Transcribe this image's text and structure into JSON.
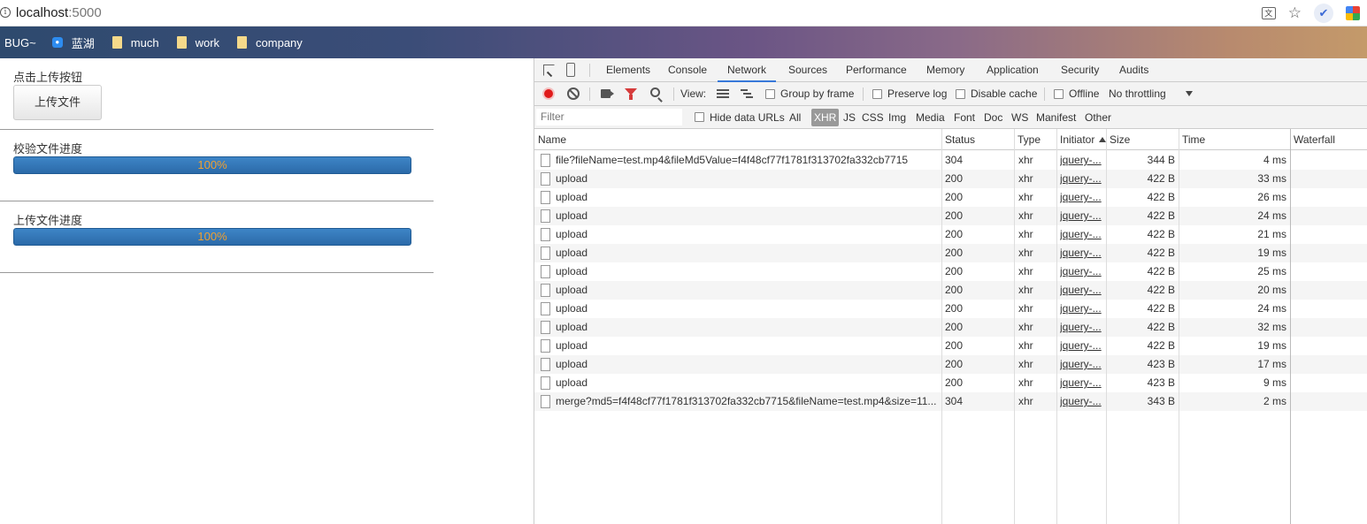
{
  "browser": {
    "url_host": "localhost",
    "url_port": ":5000",
    "info_glyph": "i",
    "translate_glyph": "文",
    "star_glyph": "☆",
    "ext1_glyph": "✔"
  },
  "bookmarks": [
    {
      "label": "BUG~",
      "icon": "none"
    },
    {
      "label": "蓝湖",
      "icon": "lanhu-icon"
    },
    {
      "label": "much",
      "icon": "folder-icon"
    },
    {
      "label": "work",
      "icon": "folder-icon"
    },
    {
      "label": "company",
      "icon": "folder-icon"
    }
  ],
  "page": {
    "upload_label": "点击上传按钮",
    "upload_button": "上传文件",
    "verify_label": "校验文件进度",
    "verify_progress": "100%",
    "verify_value": 1.0,
    "upload_progress_label": "上传文件进度",
    "upload_progress": "100%",
    "upload_value": 1.0
  },
  "devtools": {
    "tabs": [
      "Elements",
      "Console",
      "Network",
      "Sources",
      "Performance",
      "Memory",
      "Application",
      "Security",
      "Audits"
    ],
    "active_tab": "Network",
    "toolbar": {
      "view_label": "View:",
      "group_by_frame": "Group by frame",
      "preserve_log": "Preserve log",
      "disable_cache": "Disable cache",
      "offline": "Offline",
      "throttling": "No throttling"
    },
    "filterbar": {
      "filter_placeholder": "Filter",
      "hide_data_urls": "Hide data URLs",
      "types": [
        "All",
        "XHR",
        "JS",
        "CSS",
        "Img",
        "Media",
        "Font",
        "Doc",
        "WS",
        "Manifest",
        "Other"
      ],
      "active_type": "XHR"
    },
    "columns": [
      "Name",
      "Status",
      "Type",
      "Initiator",
      "Size",
      "Time",
      "Waterfall"
    ],
    "requests": [
      {
        "name": "file?fileName=test.mp4&fileMd5Value=f4f48cf77f1781f313702fa332cb7715",
        "status": "304",
        "type": "xhr",
        "initiator": "jquery-...",
        "size": "344 B",
        "time": "4 ms"
      },
      {
        "name": "upload",
        "status": "200",
        "type": "xhr",
        "initiator": "jquery-...",
        "size": "422 B",
        "time": "33 ms"
      },
      {
        "name": "upload",
        "status": "200",
        "type": "xhr",
        "initiator": "jquery-...",
        "size": "422 B",
        "time": "26 ms"
      },
      {
        "name": "upload",
        "status": "200",
        "type": "xhr",
        "initiator": "jquery-...",
        "size": "422 B",
        "time": "24 ms"
      },
      {
        "name": "upload",
        "status": "200",
        "type": "xhr",
        "initiator": "jquery-...",
        "size": "422 B",
        "time": "21 ms"
      },
      {
        "name": "upload",
        "status": "200",
        "type": "xhr",
        "initiator": "jquery-...",
        "size": "422 B",
        "time": "19 ms"
      },
      {
        "name": "upload",
        "status": "200",
        "type": "xhr",
        "initiator": "jquery-...",
        "size": "422 B",
        "time": "25 ms"
      },
      {
        "name": "upload",
        "status": "200",
        "type": "xhr",
        "initiator": "jquery-...",
        "size": "422 B",
        "time": "20 ms"
      },
      {
        "name": "upload",
        "status": "200",
        "type": "xhr",
        "initiator": "jquery-...",
        "size": "422 B",
        "time": "24 ms"
      },
      {
        "name": "upload",
        "status": "200",
        "type": "xhr",
        "initiator": "jquery-...",
        "size": "422 B",
        "time": "32 ms"
      },
      {
        "name": "upload",
        "status": "200",
        "type": "xhr",
        "initiator": "jquery-...",
        "size": "422 B",
        "time": "19 ms"
      },
      {
        "name": "upload",
        "status": "200",
        "type": "xhr",
        "initiator": "jquery-...",
        "size": "423 B",
        "time": "17 ms"
      },
      {
        "name": "upload",
        "status": "200",
        "type": "xhr",
        "initiator": "jquery-...",
        "size": "423 B",
        "time": "9 ms"
      },
      {
        "name": "merge?md5=f4f48cf77f1781f313702fa332cb7715&fileName=test.mp4&size=11...",
        "status": "304",
        "type": "xhr",
        "initiator": "jquery-...",
        "size": "343 B",
        "time": "2 ms"
      }
    ]
  },
  "colors": {
    "accent": "#3879d9",
    "record": "#e01a1a",
    "progress_bar": "#2b6aa9",
    "progress_text": "#f0a030"
  }
}
